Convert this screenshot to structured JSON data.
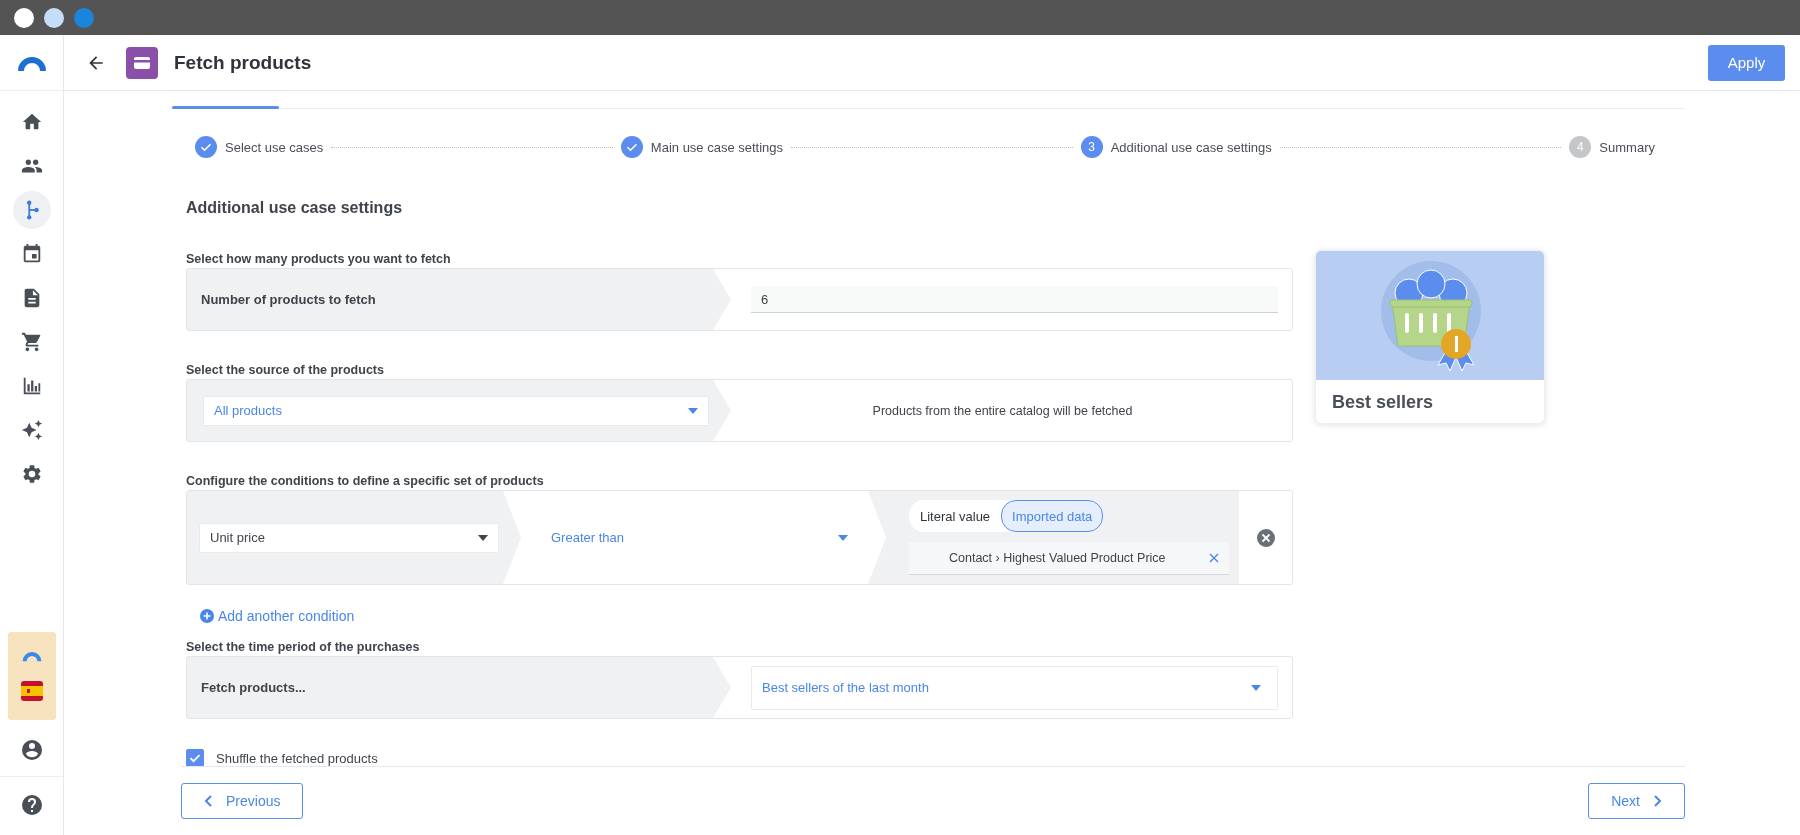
{
  "sidebar": {
    "items": [
      {
        "selected": false
      },
      {
        "selected": false
      },
      {
        "selected": true
      },
      {
        "selected": false
      },
      {
        "selected": false
      },
      {
        "selected": false
      },
      {
        "selected": false
      },
      {
        "selected": false
      },
      {
        "selected": false
      }
    ]
  },
  "header": {
    "title": "Fetch products",
    "apply_button": "Apply"
  },
  "stepper": {
    "steps": [
      {
        "label": "Select use cases",
        "completed": true,
        "selected": false
      },
      {
        "label": "Main use case settings",
        "completed": true,
        "selected": false
      },
      {
        "label": "Additional use case settings",
        "number": "3",
        "completed": false,
        "selected": true
      },
      {
        "label": "Summary",
        "number": "4",
        "completed": false,
        "selected": false
      }
    ]
  },
  "heading": "Additional use case settings",
  "product_count": {
    "label": "Select how many products you want to fetch",
    "field_label": "Number of products to fetch",
    "value": "6"
  },
  "source": {
    "label": "Select the source of the products",
    "dropdown": "All products",
    "description": "Products from the entire catalog will be fetched"
  },
  "conditions": {
    "label": "Configure the conditions to define a specific set of products",
    "items": [
      {
        "field": "Unit price",
        "operator": "Greater than",
        "value_modes": [
          {
            "label": "Literal value",
            "selected": false
          },
          {
            "label": "Imported data",
            "selected": true
          }
        ],
        "value": "Contact › Highest Valued Product Price"
      }
    ],
    "add_link": "Add another condition"
  },
  "time_period": {
    "label": "Select the time period of the purchases",
    "field_label": "Fetch products...",
    "dropdown": "Best sellers of the last month"
  },
  "shuffle": {
    "label": "Shuffle the fetched products",
    "checked": true
  },
  "card": {
    "title": "Best sellers"
  },
  "footer": {
    "previous": "Previous",
    "next": "Next"
  }
}
